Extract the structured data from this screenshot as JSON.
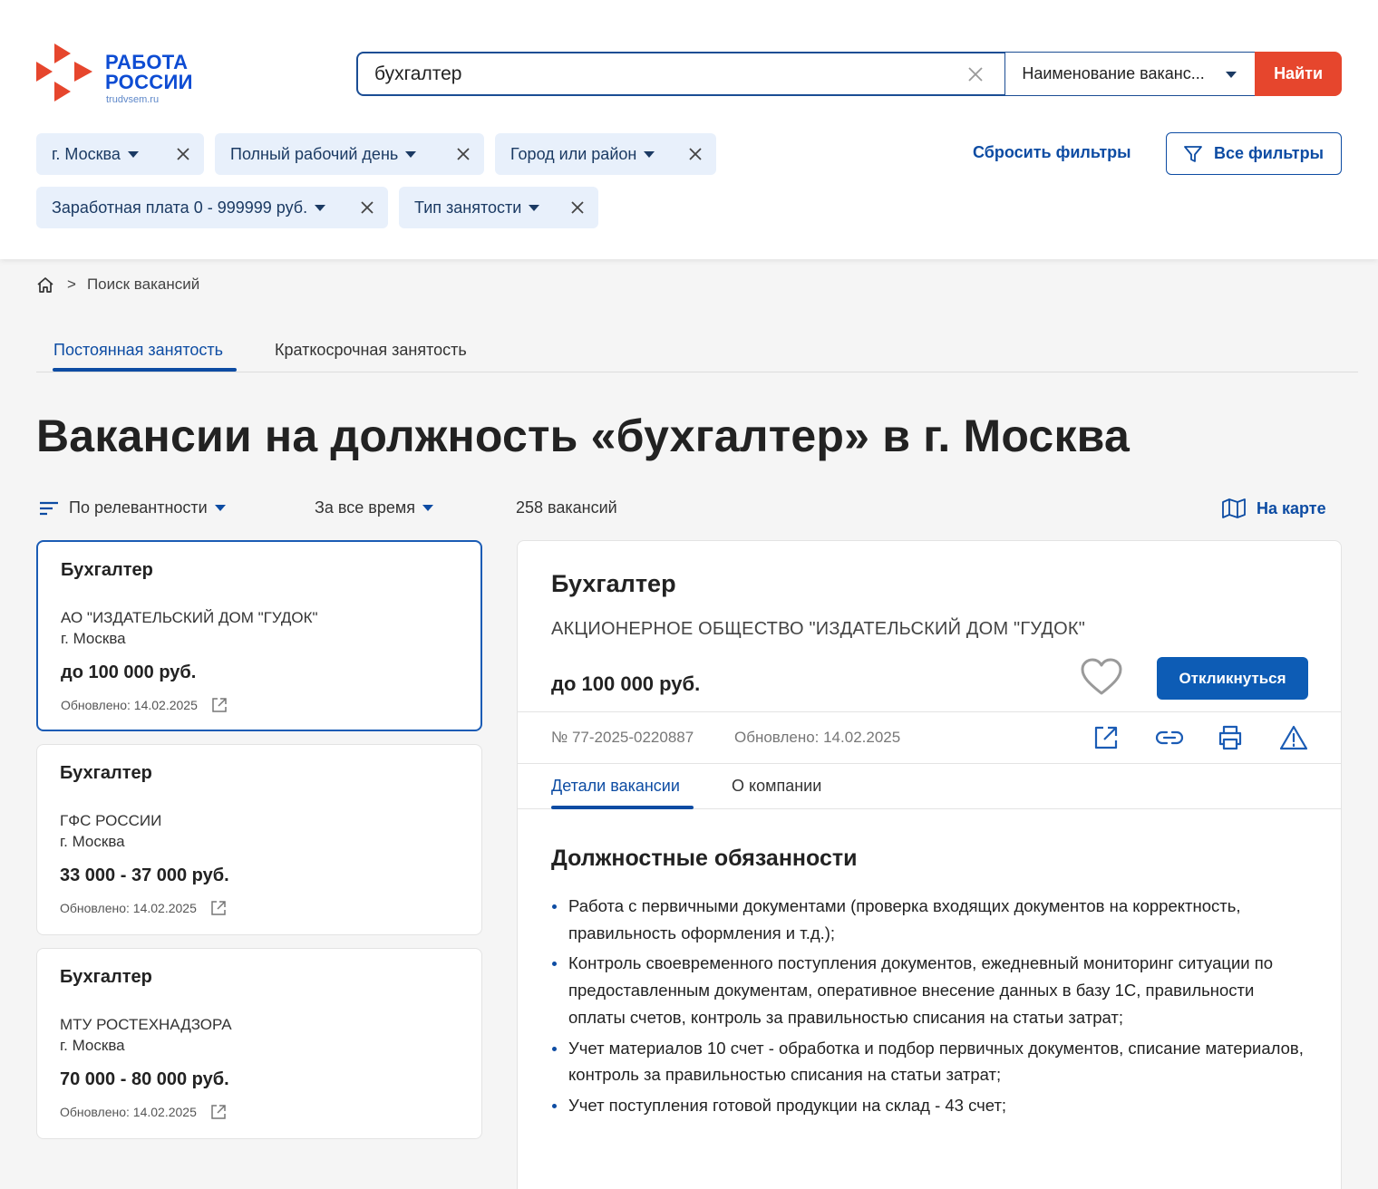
{
  "logo": {
    "line1": "РАБОТА",
    "line2": "РОССИИ",
    "site": "trudvsem.ru"
  },
  "search": {
    "query": "бухгалтер",
    "scope": "Наименование ваканс...",
    "submit_label": "Найти"
  },
  "filters": {
    "chips": [
      {
        "label": "г. Москва"
      },
      {
        "label": "Полный рабочий день"
      },
      {
        "label": "Город или район"
      },
      {
        "label": "Заработная плата 0 - 999999 руб."
      },
      {
        "label": "Тип занятости"
      }
    ],
    "reset_label": "Сбросить фильтры",
    "all_label": "Все фильтры"
  },
  "breadcrumb": {
    "separator": ">",
    "current": "Поиск вакансий"
  },
  "tabs": [
    {
      "label": "Постоянная занятость",
      "active": true
    },
    {
      "label": "Краткосрочная занятость",
      "active": false
    }
  ],
  "page_title": "Вакансии на должность «бухгалтер» в г. Москва",
  "sort": {
    "relevance": "По релевантности",
    "period": "За все время",
    "count": "258 вакансий",
    "map": "На карте"
  },
  "vacancies": [
    {
      "title": "Бухгалтер",
      "company": "АО \"ИЗДАТЕЛЬСКИЙ ДОМ \"ГУДОК\"",
      "city": "г. Москва",
      "salary": "до 100 000 руб.",
      "updated": "Обновлено: 14.02.2025"
    },
    {
      "title": "Бухгалтер",
      "company": "ГФС РОССИИ",
      "city": "г. Москва",
      "salary": "33 000 - 37 000 руб.",
      "updated": "Обновлено: 14.02.2025"
    },
    {
      "title": "Бухгалтер",
      "company": "МТУ РОСТЕХНАДЗОРА",
      "city": "г. Москва",
      "salary": "70 000 - 80 000 руб.",
      "updated": "Обновлено: 14.02.2025"
    }
  ],
  "detail": {
    "title": "Бухгалтер",
    "company": "АКЦИОНЕРНОЕ ОБЩЕСТВО \"ИЗДАТЕЛЬСКИЙ ДОМ \"ГУДОК\"",
    "salary": "до 100 000 руб.",
    "apply_label": "Откликнуться",
    "number": "№ 77-2025-0220887",
    "updated": "Обновлено: 14.02.2025",
    "tabs": [
      {
        "label": "Детали вакансии"
      },
      {
        "label": "О компании"
      }
    ],
    "section_title": "Должностные обязанности",
    "duties": [
      "Работа с первичными документами (проверка входящих документов на корректность, правильность оформления и т.д.);",
      "Контроль своевременного поступления документов, ежедневный мониторинг ситуации по предоставленным документам, оперативное внесение данных в базу 1С, правильности оплаты счетов, контроль за правильностью списания на статьи затрат;",
      "Учет материалов 10 счет - обработка и подбор первичных документов, списание материалов, контроль за правильностью списания на статьи затрат;",
      "Учет поступления готовой продукции на склад - 43 счет;"
    ]
  },
  "colors": {
    "brand_red": "#e6462d",
    "brand_blue": "#0d4ca3",
    "chip_bg": "#e8f0fb"
  },
  "icons": [
    "logo-mark-icon",
    "clear-icon",
    "chevron-down-icon",
    "close-icon",
    "filter-funnel-icon",
    "home-icon",
    "sort-lines-icon",
    "map-icon",
    "external-link-icon",
    "heart-icon",
    "link-icon",
    "print-icon",
    "warning-icon"
  ]
}
